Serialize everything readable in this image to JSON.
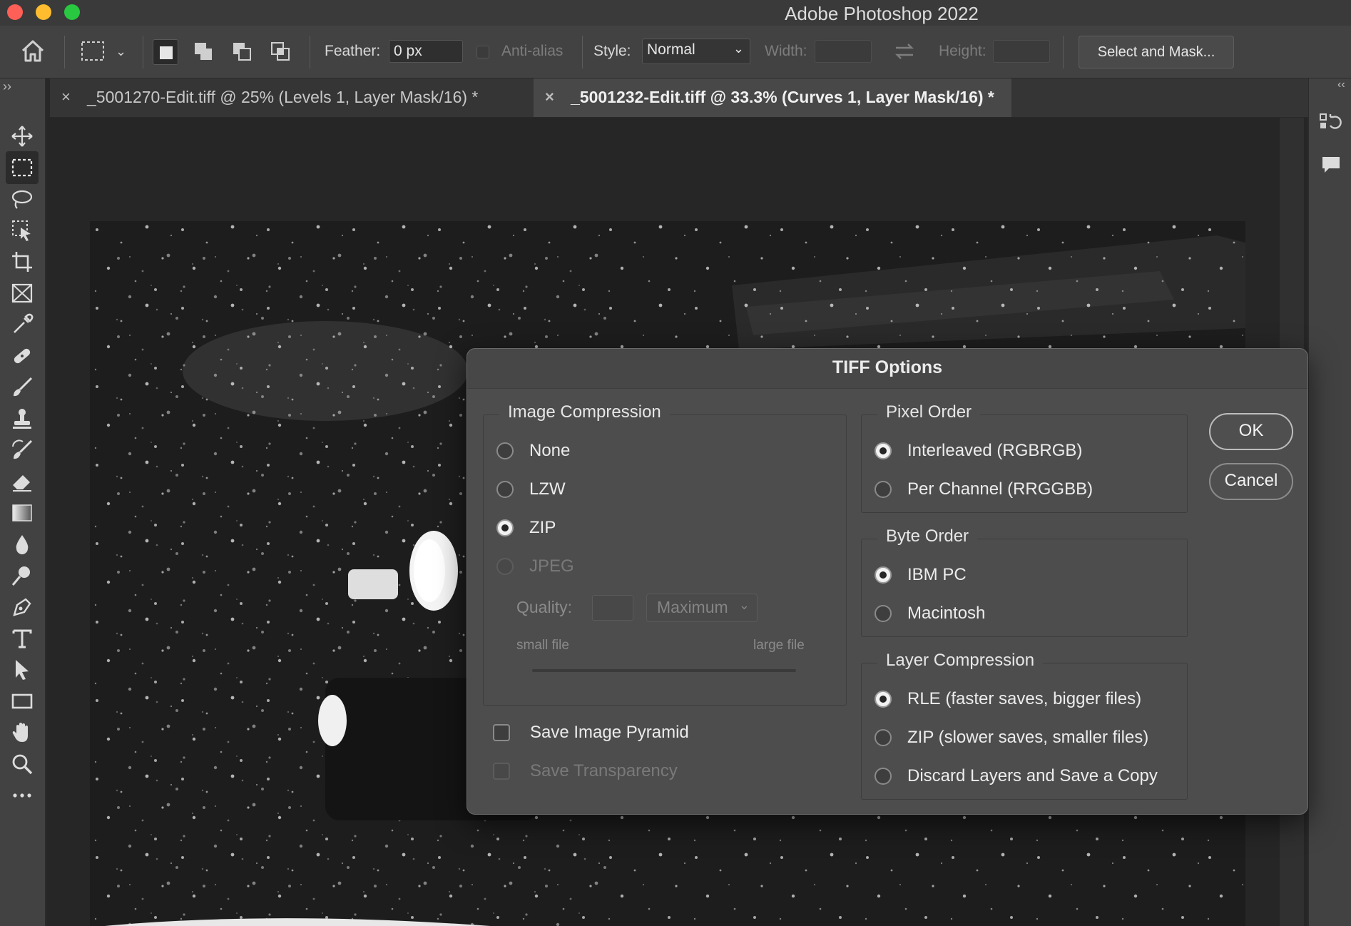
{
  "window": {
    "title": "Adobe Photoshop 2022"
  },
  "options_bar": {
    "feather_label": "Feather:",
    "feather_value": "0 px",
    "anti_alias_label": "Anti-alias",
    "style_label": "Style:",
    "style_value": "Normal",
    "width_label": "Width:",
    "height_label": "Height:",
    "select_and_mask_label": "Select and Mask..."
  },
  "tabs": [
    {
      "label": "_5001270-Edit.tiff @ 25% (Levels 1, Layer Mask/16) *",
      "close": "×",
      "active": false
    },
    {
      "label": "_5001232-Edit.tiff @ 33.3% (Curves 1, Layer Mask/16) *",
      "close": "×",
      "active": true
    }
  ],
  "tools": [
    "move-icon",
    "marquee-icon",
    "lasso-icon",
    "object-select-icon",
    "crop-icon",
    "frame-icon",
    "eyedropper-icon",
    "healing-icon",
    "brush-icon",
    "stamp-icon",
    "history-brush-icon",
    "eraser-icon",
    "gradient-icon",
    "blur-icon",
    "dodge-icon",
    "pen-icon",
    "type-icon",
    "path-select-icon",
    "rectangle-icon",
    "hand-icon",
    "zoom-icon",
    "more-icon"
  ],
  "dialog": {
    "title": "TIFF Options",
    "image_compression": {
      "legend": "Image Compression",
      "options": [
        {
          "label": "None",
          "selected": false,
          "enabled": true
        },
        {
          "label": "LZW",
          "selected": false,
          "enabled": true
        },
        {
          "label": "ZIP",
          "selected": true,
          "enabled": true
        },
        {
          "label": "JPEG",
          "selected": false,
          "enabled": false
        }
      ],
      "quality_label": "Quality:",
      "quality_value": "",
      "quality_select": "Maximum",
      "small_file": "small file",
      "large_file": "large file"
    },
    "save_image_pyramid": {
      "label": "Save Image Pyramid",
      "checked": false,
      "enabled": true
    },
    "save_transparency": {
      "label": "Save Transparency",
      "checked": false,
      "enabled": false
    },
    "pixel_order": {
      "legend": "Pixel Order",
      "options": [
        {
          "label": "Interleaved (RGBRGB)",
          "selected": true
        },
        {
          "label": "Per Channel (RRGGBB)",
          "selected": false
        }
      ]
    },
    "byte_order": {
      "legend": "Byte Order",
      "options": [
        {
          "label": "IBM PC",
          "selected": true
        },
        {
          "label": "Macintosh",
          "selected": false
        }
      ]
    },
    "layer_compression": {
      "legend": "Layer Compression",
      "options": [
        {
          "label": "RLE (faster saves, bigger files)",
          "selected": true
        },
        {
          "label": "ZIP (slower saves, smaller files)",
          "selected": false
        },
        {
          "label": "Discard Layers and Save a Copy",
          "selected": false
        }
      ]
    },
    "ok_label": "OK",
    "cancel_label": "Cancel"
  }
}
